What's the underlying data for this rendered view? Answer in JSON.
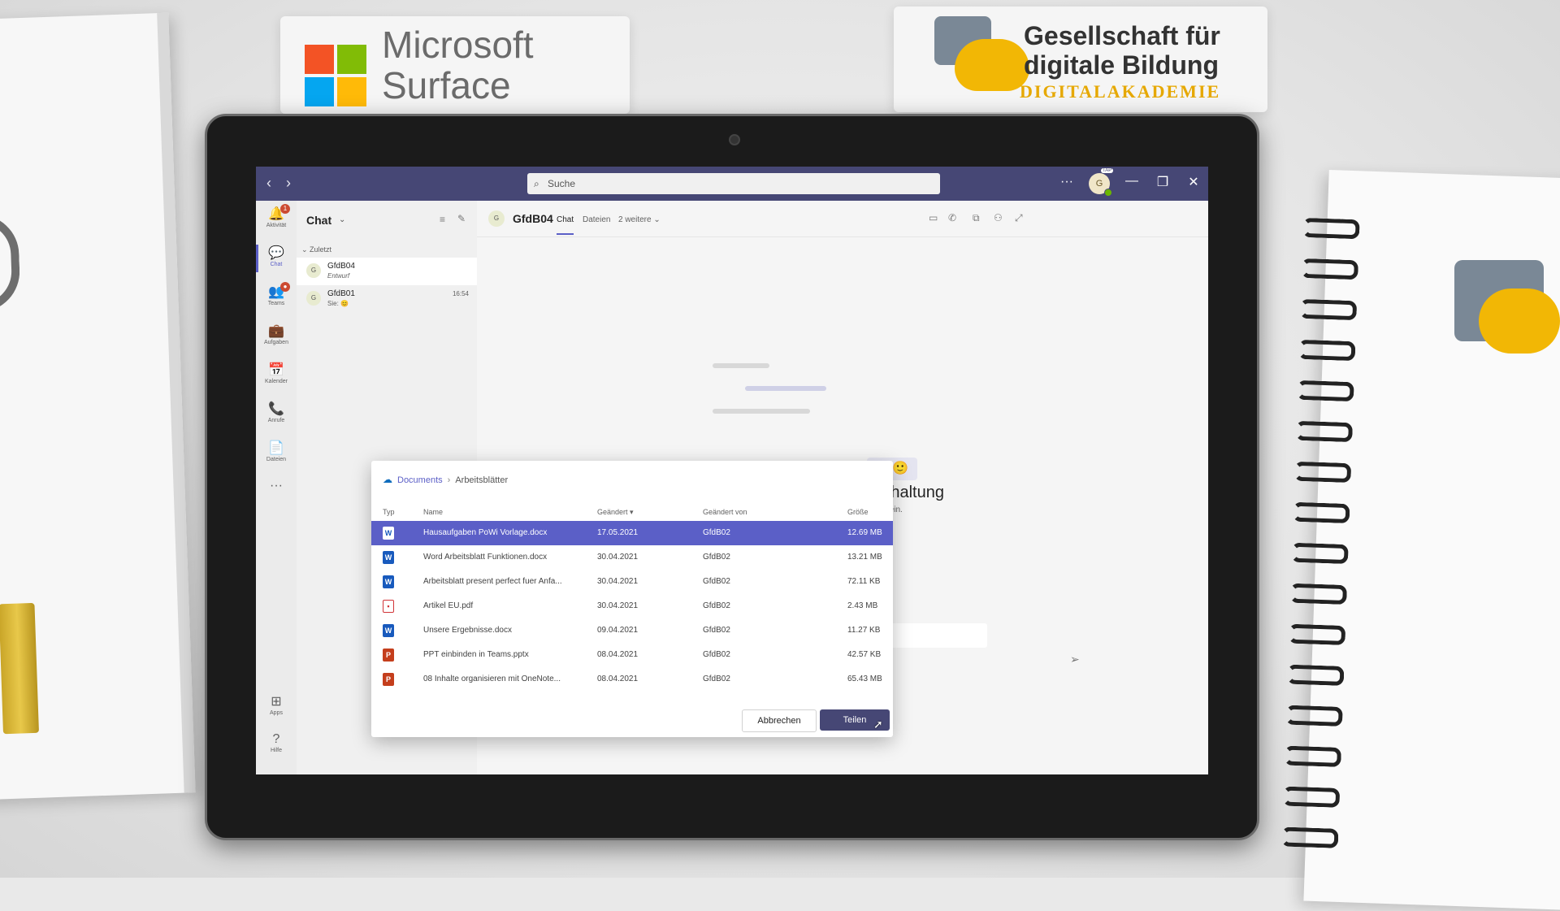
{
  "scene": {
    "brand_microsoft": {
      "line1": "Microsoft",
      "line2": "Surface"
    },
    "brand_gdb": {
      "line1": "Gesellschaft für",
      "line2": "digitale Bildung",
      "line3": "DIGITALAKADEMIE"
    }
  },
  "titlebar": {
    "back": "‹",
    "forward": "›",
    "search_placeholder": "Suche",
    "more": "···",
    "avatar_initial": "G",
    "avatar_badge": "TAP",
    "minimize": "—",
    "maximize": "❐",
    "close": "✕"
  },
  "rail": {
    "items": [
      {
        "label": "Aktivität",
        "icon": "bell-icon",
        "glyph": "🔔",
        "badge": "1"
      },
      {
        "label": "Chat",
        "icon": "chat-icon",
        "glyph": "💬"
      },
      {
        "label": "Teams",
        "icon": "teams-icon",
        "glyph": "👥",
        "badge": "●"
      },
      {
        "label": "Aufgaben",
        "icon": "briefcase-icon",
        "glyph": "💼"
      },
      {
        "label": "Kalender",
        "icon": "calendar-icon",
        "glyph": "📅"
      },
      {
        "label": "Anrufe",
        "icon": "phone-icon",
        "glyph": "📞"
      },
      {
        "label": "Dateien",
        "icon": "file-icon",
        "glyph": "📄"
      }
    ],
    "more": "···",
    "apps_label": "Apps",
    "help_label": "Hilfe"
  },
  "chatlist": {
    "title": "Chat",
    "section": "Zuletzt",
    "items": [
      {
        "initial": "G",
        "name": "GfdB04",
        "sub": "Entwurf",
        "time": ""
      },
      {
        "initial": "G",
        "name": "GfdB01",
        "sub": "Sie: 😊",
        "time": "16:54"
      }
    ]
  },
  "main": {
    "avatar_initial": "G",
    "name": "GfdB04",
    "tabs": [
      {
        "label": "Chat"
      },
      {
        "label": "Dateien"
      },
      {
        "label": "2 weitere ⌄"
      }
    ],
    "empty_title": "terhaltung",
    "empty_sub": "richt ein."
  },
  "dialog": {
    "breadcrumb_root": "Documents",
    "breadcrumb_current": "Arbeitsblätter",
    "columns": {
      "type": "Typ",
      "name": "Name",
      "modified": "Geändert ▾",
      "modified_by": "Geändert von",
      "size": "Größe"
    },
    "files": [
      {
        "kind": "word",
        "name": "Hausaufgaben PoWi Vorlage.docx",
        "modified": "17.05.2021",
        "by": "GfdB02",
        "size": "12.69 MB",
        "selected": true
      },
      {
        "kind": "word",
        "name": "Word Arbeitsblatt Funktionen.docx",
        "modified": "30.04.2021",
        "by": "GfdB02",
        "size": "13.21 MB"
      },
      {
        "kind": "word",
        "name": "Arbeitsblatt present perfect fuer Anfa...",
        "modified": "30.04.2021",
        "by": "GfdB02",
        "size": "72.11 KB"
      },
      {
        "kind": "pdf",
        "name": "Artikel EU.pdf",
        "modified": "30.04.2021",
        "by": "GfdB02",
        "size": "2.43 MB"
      },
      {
        "kind": "word",
        "name": "Unsere Ergebnisse.docx",
        "modified": "09.04.2021",
        "by": "GfdB02",
        "size": "11.27 KB"
      },
      {
        "kind": "ppt",
        "name": "PPT einbinden in Teams.pptx",
        "modified": "08.04.2021",
        "by": "GfdB02",
        "size": "42.57 KB"
      },
      {
        "kind": "ppt",
        "name": "08 Inhalte organisieren mit OneNote...",
        "modified": "08.04.2021",
        "by": "GfdB02",
        "size": "65.43 MB"
      }
    ],
    "cancel_label": "Abbrechen",
    "share_label": "Teilen"
  },
  "colors": {
    "teams_purple": "#464775",
    "accent": "#5b5fc7"
  }
}
